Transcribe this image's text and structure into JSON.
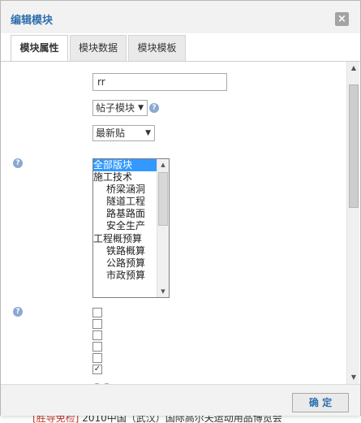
{
  "dialog": {
    "title": "编辑模块",
    "close_label": "×",
    "tabs": [
      {
        "label": "模块属性",
        "active": true
      },
      {
        "label": "模块数据",
        "active": false
      },
      {
        "label": "模块模板",
        "active": false
      }
    ],
    "ok_label": "确 定"
  },
  "form": {
    "name_value": "rr",
    "module_type": {
      "value": "帖子模块",
      "help_icon": "question-icon"
    },
    "sort_select": {
      "value": "最新贴"
    },
    "help_mark": "?",
    "forum_list": {
      "items": [
        {
          "label": "全部版块",
          "indent": false,
          "selected": true
        },
        {
          "label": "施工技术",
          "indent": false,
          "selected": false
        },
        {
          "label": "桥梁涵洞",
          "indent": true,
          "selected": false
        },
        {
          "label": "隧道工程",
          "indent": true,
          "selected": false
        },
        {
          "label": "路基路面",
          "indent": true,
          "selected": false
        },
        {
          "label": "安全生产",
          "indent": true,
          "selected": false
        },
        {
          "label": "工程概预算",
          "indent": false,
          "selected": false
        },
        {
          "label": "铁路概算",
          "indent": true,
          "selected": false
        },
        {
          "label": "公路预算",
          "indent": true,
          "selected": false
        },
        {
          "label": "市政预算",
          "indent": true,
          "selected": false
        }
      ]
    },
    "checkboxes": [
      false,
      false,
      false,
      false,
      false,
      true
    ]
  },
  "background": {
    "bottom_tag": "[胜导免检]",
    "bottom_text": " 2010中国（武汉）国际高尔夫运动用品博览会"
  },
  "colors": {
    "title": "#2f6fae",
    "selected_item": "#3399ff"
  }
}
